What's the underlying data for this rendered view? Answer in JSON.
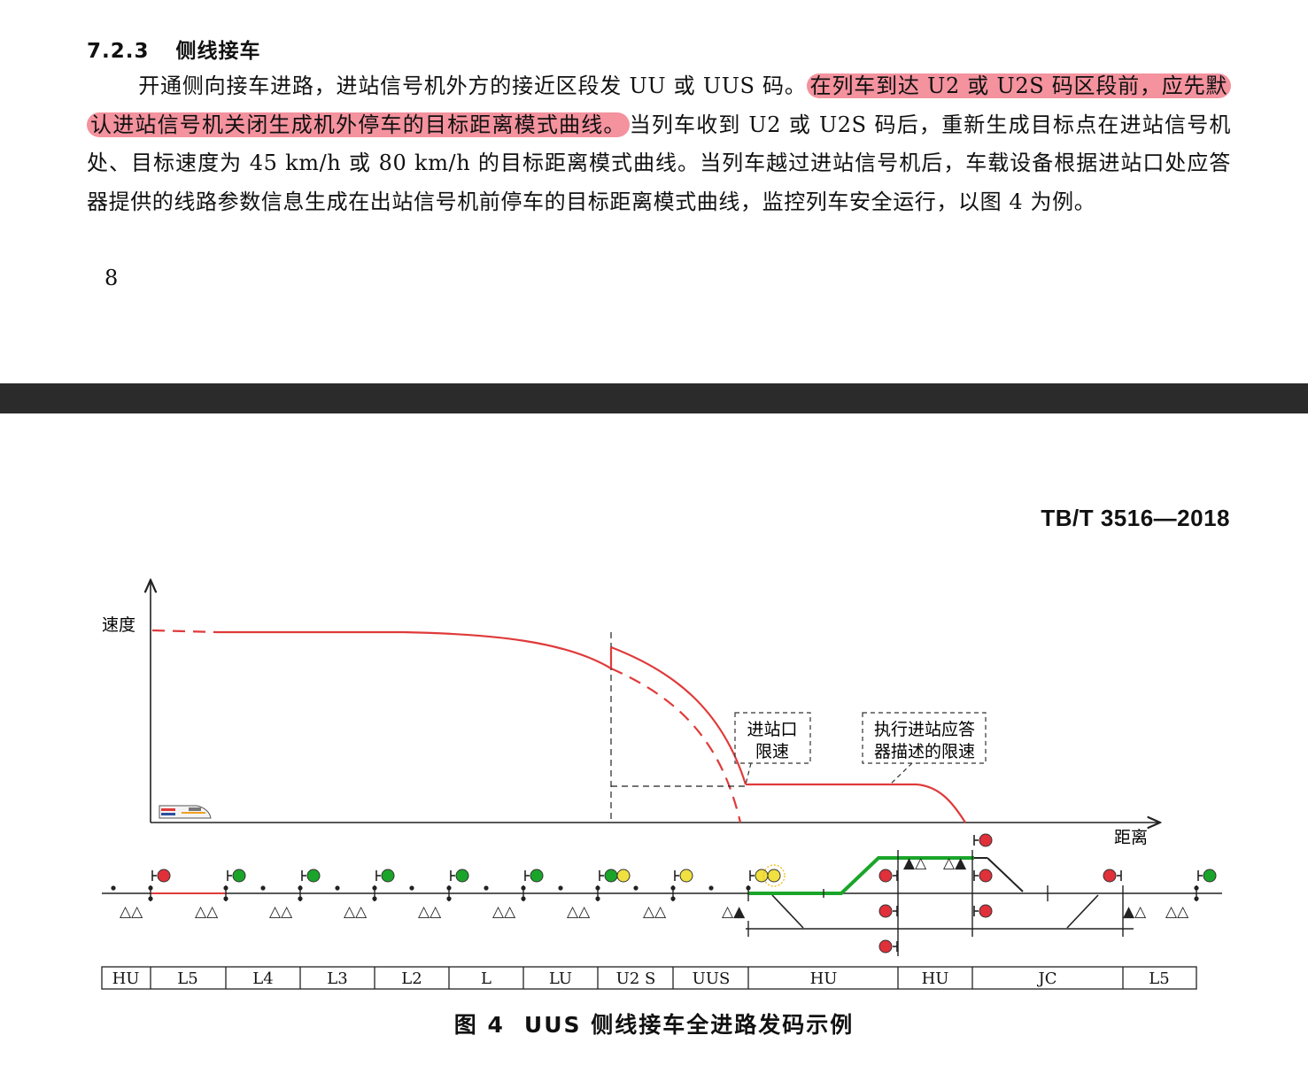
{
  "top_page": {
    "section_number": "7.2.3",
    "section_title": "侧线接车",
    "para_part1": "开通侧向接车进路，进站信号机外方的接近区段发 UU 或 UUS 码。",
    "para_highlight": "在列车到达 U2 或 U2S 码区段前，应先默认进站信号机关闭生成机外停车的目标距离模式曲线。",
    "para_part2": "当列车收到 U2 或 U2S 码后，重新生成目标点在进站信号机处、目标速度为 45 km/h 或 80 km/h 的目标距离模式曲线。当列车越过进站信号机后，车载设备根据进站口处应答器提供的线路参数信息生成在出站信号机前停车的目标距离模式曲线，监控列车安全运行，以图 4 为例。",
    "page_number": "8",
    "highlight_color": "#f06e7d"
  },
  "bottom_page": {
    "standard_number": "TB/T 3516—2018",
    "figure": {
      "y_axis_label": "速度",
      "x_axis_label": "距离",
      "annotation_1": [
        "进站口",
        "限速"
      ],
      "annotation_2": [
        "执行进站应答",
        "器描述的限速"
      ],
      "track_sections": [
        "HU",
        "L5",
        "L4",
        "L3",
        "L2",
        "L",
        "LU",
        "U2 S",
        "UUS",
        "HU",
        "HU",
        "JC",
        "L5"
      ],
      "colors": {
        "curve": "#e03a3a",
        "route": "#1aa52a",
        "signal_red": "#e0303a",
        "signal_green": "#1aa52a",
        "signal_yellow": "#f0e040"
      }
    },
    "caption_number": "图 4",
    "caption_text": "UUS 侧线接车全进路发码示例"
  }
}
